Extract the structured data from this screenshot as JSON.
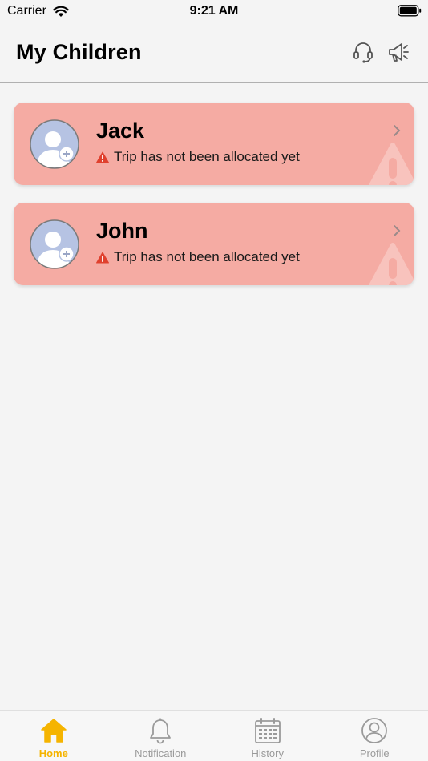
{
  "status_bar": {
    "carrier": "Carrier",
    "time": "9:21 AM",
    "icons": [
      "wifi-icon",
      "battery-icon"
    ]
  },
  "header": {
    "title": "My Children",
    "icons": [
      "support-headset-icon",
      "announcement-megaphone-icon"
    ]
  },
  "children": [
    {
      "name": "Jack",
      "status": "Trip has not been allocated yet"
    },
    {
      "name": "John",
      "status": "Trip has not been allocated yet"
    }
  ],
  "tab_bar": {
    "tabs": [
      {
        "label": "Home",
        "icon": "home-icon",
        "active": true
      },
      {
        "label": "Notification",
        "icon": "bell-icon",
        "active": false
      },
      {
        "label": "History",
        "icon": "calendar-icon",
        "active": false
      },
      {
        "label": "Profile",
        "icon": "profile-icon",
        "active": false
      }
    ]
  },
  "colors": {
    "card_background": "#f5aba3",
    "warning": "#e0412e",
    "active_tab": "#f5b400",
    "inactive_tab": "#9a9a9a",
    "avatar": "#b6c3e3"
  }
}
